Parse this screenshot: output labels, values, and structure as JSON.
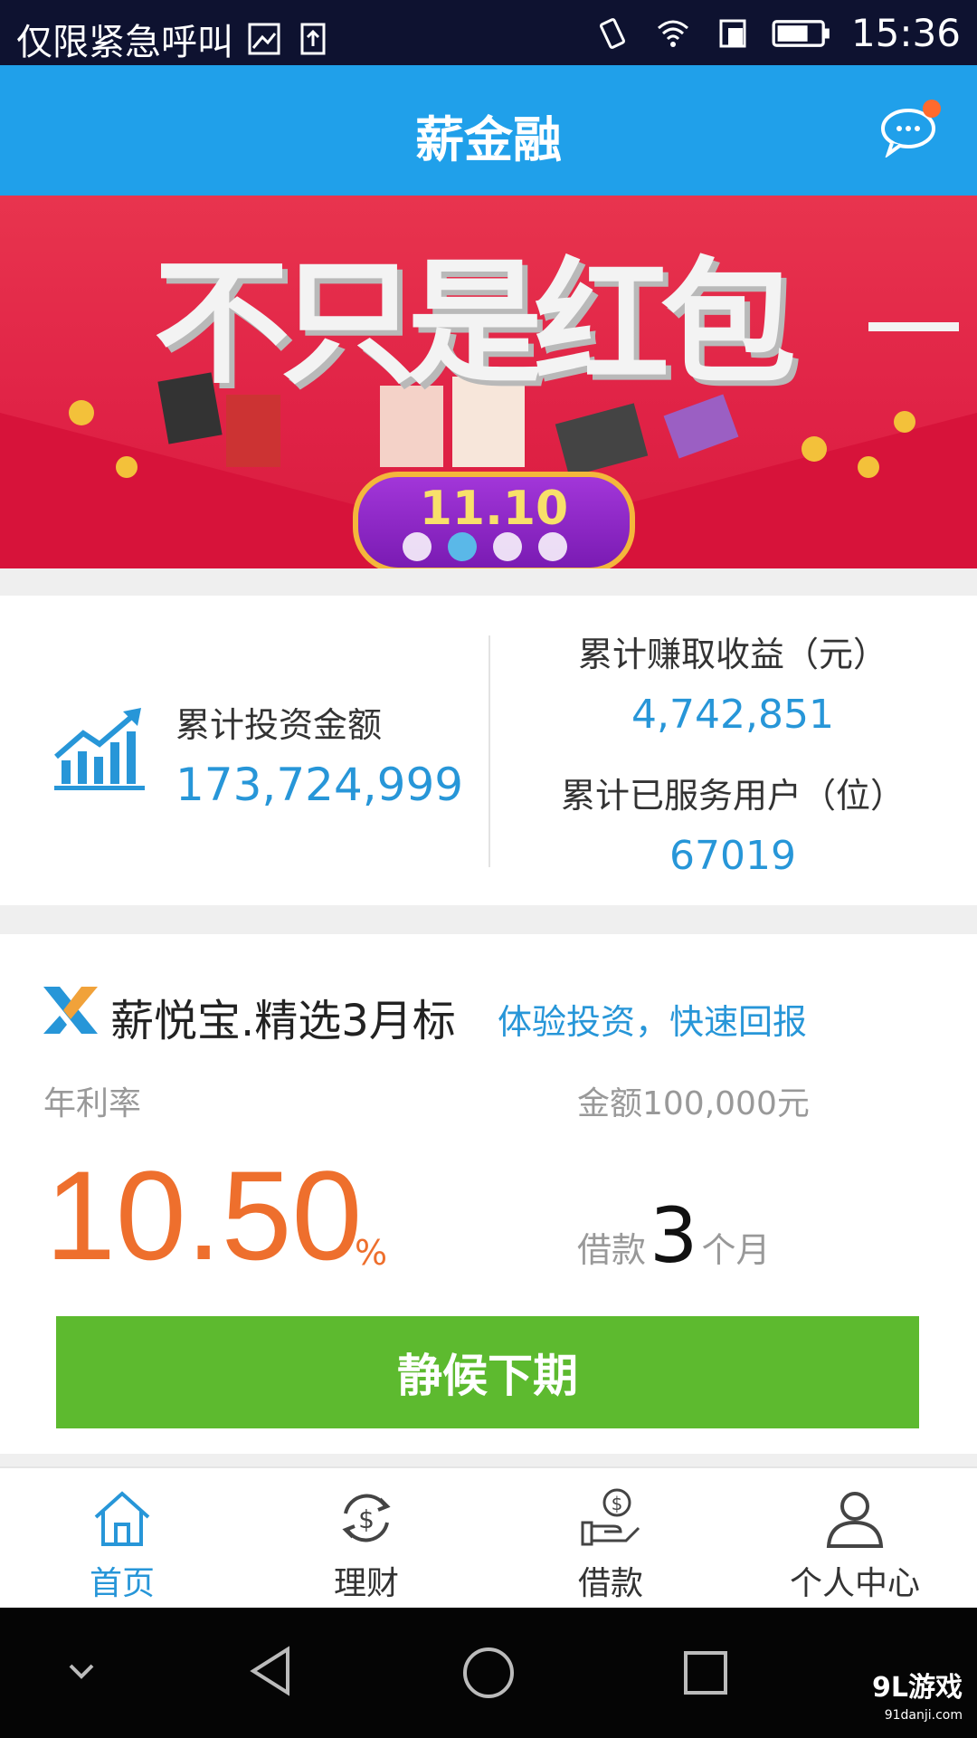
{
  "status_bar": {
    "carrier": "仅限紧急呼叫",
    "time": "15:36"
  },
  "header": {
    "title": "薪金融",
    "message_icon": "chat-bubble-icon",
    "has_notification_dot": true
  },
  "banner": {
    "headline": "不只是红包",
    "date_badge": "11.10",
    "slide_count": 4,
    "active_slide": 2
  },
  "stats": {
    "total_invest_label": "累计投资金额",
    "total_invest_value": "173,724,999",
    "earned_label": "累计赚取收益（元）",
    "earned_value": "4,742,851",
    "users_label": "累计已服务用户（位）",
    "users_value": "67019"
  },
  "product": {
    "name": "薪悦宝.精选3月标",
    "slogan": "体验投资，快速回报",
    "rate_label": "年利率",
    "rate_value": "10.50",
    "rate_unit": "%",
    "amount_label": "金额100,000元",
    "term_prefix": "借款",
    "term_value": "3",
    "term_suffix": "个月",
    "cta_label": "静候下期"
  },
  "tabs": [
    {
      "label": "首页",
      "icon": "home-icon",
      "active": true
    },
    {
      "label": "理财",
      "icon": "money-cycle-icon",
      "active": false
    },
    {
      "label": "借款",
      "icon": "hand-coin-icon",
      "active": false
    },
    {
      "label": "个人中心",
      "icon": "user-icon",
      "active": false
    }
  ],
  "watermark": {
    "brand": "9L游戏",
    "site": "91danji.com"
  },
  "colors": {
    "primary_blue": "#20a0ea",
    "accent_orange": "#ee6f2d",
    "cta_green": "#5dba2f",
    "value_blue": "#2796d8"
  }
}
